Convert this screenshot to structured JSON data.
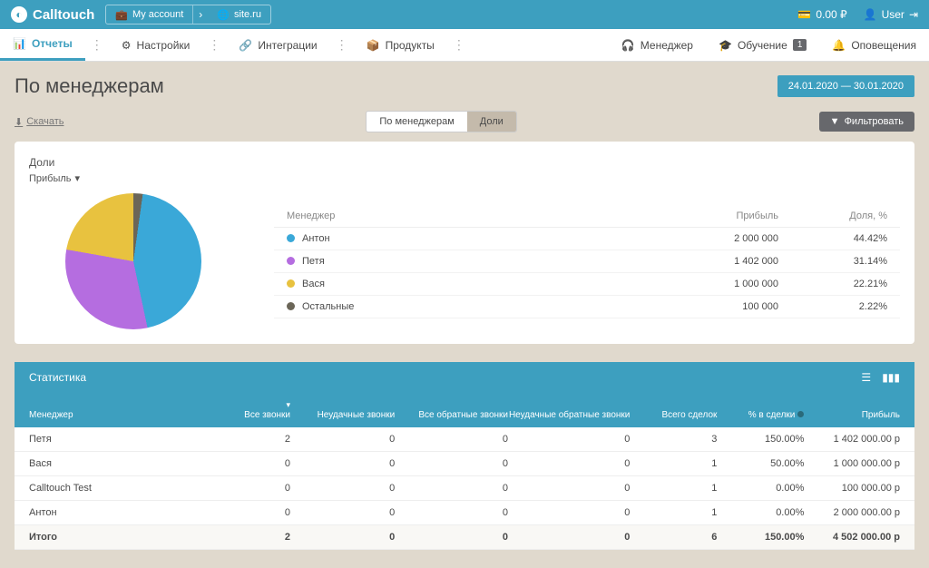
{
  "brand": "Calltouch",
  "breadcrumb": {
    "account": "My account",
    "site": "site.ru"
  },
  "balance": "0.00 ₽",
  "user": "User",
  "nav": {
    "reports": "Отчеты",
    "settings": "Настройки",
    "integrations": "Интеграции",
    "products": "Продукты",
    "manager": "Менеджер",
    "training": "Обучение",
    "training_badge": "1",
    "notifications": "Оповещения"
  },
  "page": {
    "title": "По менеджерам",
    "date_range": "24.01.2020 — 30.01.2020",
    "download": "Скачать",
    "tab_managers": "По менеджерам",
    "tab_shares": "Доли",
    "filter": "Фильтровать"
  },
  "card": {
    "title": "Доли",
    "metric": "Прибыль",
    "headers": {
      "manager": "Менеджер",
      "profit": "Прибыль",
      "share": "Доля, %"
    },
    "rows": [
      {
        "name": "Антон",
        "profit": "2 000 000",
        "share": "44.42%",
        "color": "#3aa8d8"
      },
      {
        "name": "Петя",
        "profit": "1 402 000",
        "share": "31.14%",
        "color": "#b56de0"
      },
      {
        "name": "Вася",
        "profit": "1 000 000",
        "share": "22.21%",
        "color": "#e8c23f"
      },
      {
        "name": "Остальные",
        "profit": "100 000",
        "share": "2.22%",
        "color": "#6b6658"
      }
    ]
  },
  "chart_data": {
    "type": "pie",
    "title": "Доли — Прибыль",
    "categories": [
      "Антон",
      "Петя",
      "Вася",
      "Остальные"
    ],
    "values": [
      2000000,
      1402000,
      1000000,
      100000
    ],
    "shares_pct": [
      44.42,
      31.14,
      22.21,
      2.22
    ],
    "colors": [
      "#3aa8d8",
      "#b56de0",
      "#e8c23f",
      "#6b6658"
    ]
  },
  "stats": {
    "title": "Статистика",
    "cols": {
      "manager": "Менеджер",
      "all_calls": "Все звонки",
      "failed_calls": "Неудачные звонки",
      "all_callbacks": "Все обратные звонки",
      "failed_callbacks": "Неудачные обратные звонки",
      "total_deals": "Всего сделок",
      "pct_deals": "% в сделки",
      "profit": "Прибыль"
    },
    "rows": [
      {
        "m": "Петя",
        "c1": "2",
        "c2": "0",
        "c3": "0",
        "c4": "0",
        "c5": "3",
        "c6": "150.00%",
        "c7": "1 402 000.00 р"
      },
      {
        "m": "Вася",
        "c1": "0",
        "c2": "0",
        "c3": "0",
        "c4": "0",
        "c5": "1",
        "c6": "50.00%",
        "c7": "1 000 000.00 р"
      },
      {
        "m": "Calltouch Test",
        "c1": "0",
        "c2": "0",
        "c3": "0",
        "c4": "0",
        "c5": "1",
        "c6": "0.00%",
        "c7": "100 000.00 р"
      },
      {
        "m": "Антон",
        "c1": "0",
        "c2": "0",
        "c3": "0",
        "c4": "0",
        "c5": "1",
        "c6": "0.00%",
        "c7": "2 000 000.00 р"
      }
    ],
    "total": {
      "m": "Итого",
      "c1": "2",
      "c2": "0",
      "c3": "0",
      "c4": "0",
      "c5": "6",
      "c6": "150.00%",
      "c7": "4 502 000.00 р"
    }
  }
}
